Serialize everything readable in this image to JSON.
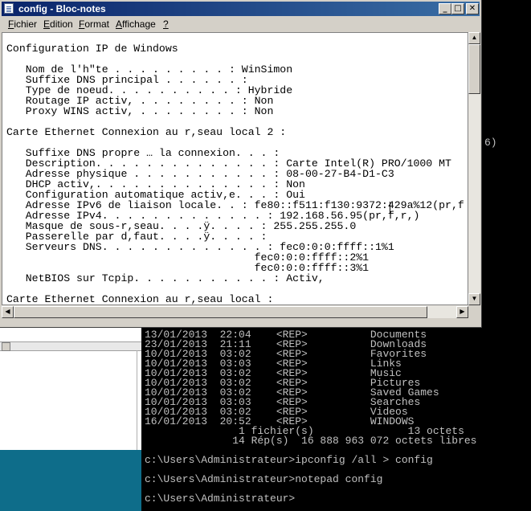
{
  "notepad": {
    "title": "config - Bloc-notes",
    "buttons": {
      "minimize": "_",
      "maximize": "□",
      "close": "✕"
    },
    "menu": [
      {
        "accel": "F",
        "rest": "ichier"
      },
      {
        "accel": "E",
        "rest": "dition"
      },
      {
        "accel": "F",
        "rest": "ormat"
      },
      {
        "accel": "A",
        "rest": "ffichage"
      },
      {
        "accel": "?",
        "rest": ""
      }
    ],
    "content": "Configuration IP de Windows\n\n   Nom de l'h\"te . . . . . . . . . : WinSimon\n   Suffixe DNS principal . . . . . . :\n   Type de noeud. . . . . . . . . . : Hybride\n   Routage IP activ, . . . . . . . . : Non\n   Proxy WINS activ, . . . . . . . . : Non\n\nCarte Ethernet Connexion au r,seau local 2 :\n\n   Suffixe DNS propre … la connexion. . . :\n   Description. . . . . . . . . . . . . . : Carte Intel(R) PRO/1000 MT\n   Adresse physique . . . . . . . . . . . : 08-00-27-B4-D1-C3\n   DHCP activ,. . . . . . . . . . . . . . : Non\n   Configuration automatique activ,e. . . : Oui\n   Adresse IPv6 de liaison locale. . : fe80::f511:f130:9372:429a%12(pr,f\n   Adresse IPv4. . . . . . . . . . . . . : 192.168.56.95(pr,f,r,)\n   Masque de sous-r,seau. . . .ÿ. . . . : 255.255.255.0\n   Passerelle par d,faut. . . .ÿ. . . . :\n   Serveurs DNS. . . . . . . . . . . . . : fec0:0:0:ffff::1%1\n                                       fec0:0:0:ffff::2%1\n                                       fec0:0:0:ffff::3%1\n   NetBIOS sur Tcpip. . . . . . . . . . . : Activ,\n\nCarte Ethernet Connexion au r,seau local :"
  },
  "console": {
    "fragment": "6)",
    "lines": [
      "13/01/2013  22:04    <REP>          Documents",
      "23/01/2013  21:11    <REP>          Downloads",
      "10/01/2013  03:02    <REP>          Favorites",
      "10/01/2013  03:03    <REP>          Links",
      "10/01/2013  03:02    <REP>          Music",
      "10/01/2013  03:02    <REP>          Pictures",
      "10/01/2013  03:02    <REP>          Saved Games",
      "10/01/2013  03:03    <REP>          Searches",
      "10/01/2013  03:02    <REP>          Videos",
      "16/01/2013  20:52    <REP>          WINDOWS",
      "               1 fichier(s)               13 octets",
      "              14 Rép(s)  16 888 963 072 octets libres",
      "",
      "c:\\Users\\Administrateur>ipconfig /all > config",
      "",
      "c:\\Users\\Administrateur>notepad config",
      "",
      "c:\\Users\\Administrateur>"
    ]
  },
  "colors": {
    "titlebar_start": "#0a246a",
    "titlebar_end": "#3a6ea5",
    "console_bg": "#000000",
    "console_text": "#c0c0c0",
    "desktop_teal": "#0e6d8a"
  }
}
